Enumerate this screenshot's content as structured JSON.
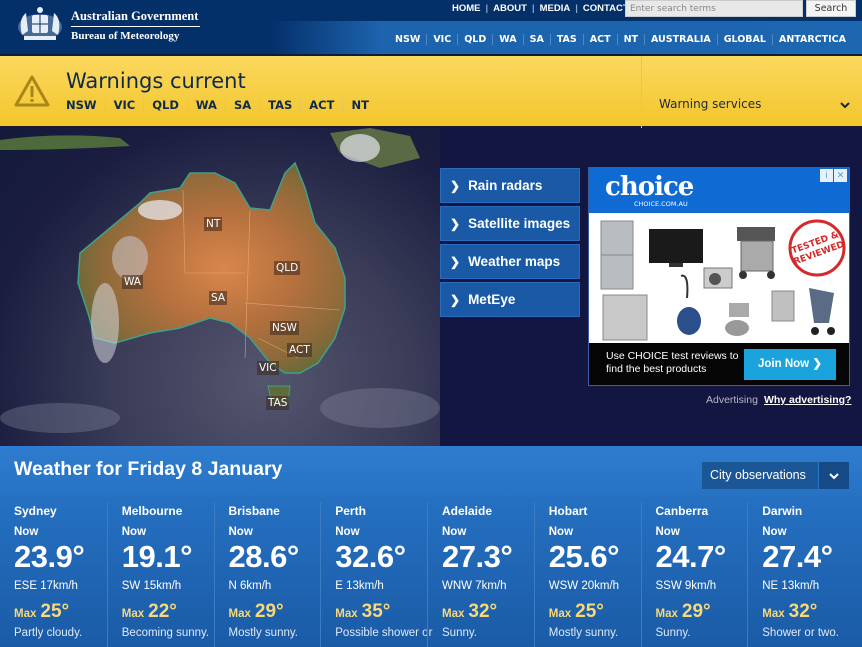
{
  "header": {
    "org_name": "Australian Government",
    "agency_name": "Bureau of Meteorology",
    "top_links": [
      "HOME",
      "ABOUT",
      "MEDIA",
      "CONTACTS"
    ],
    "search_placeholder": "Enter search terms",
    "search_button": "Search",
    "region_links": [
      "NSW",
      "VIC",
      "QLD",
      "WA",
      "SA",
      "TAS",
      "ACT",
      "NT",
      "AUSTRALIA",
      "GLOBAL",
      "ANTARCTICA"
    ]
  },
  "warnings": {
    "title": "Warnings current",
    "states": [
      "NSW",
      "VIC",
      "QLD",
      "WA",
      "SA",
      "TAS",
      "ACT",
      "NT"
    ],
    "services_label": "Warning services",
    "accent_color": "#f5c932"
  },
  "map": {
    "labels": [
      "NT",
      "WA",
      "QLD",
      "SA",
      "NSW",
      "ACT",
      "VIC",
      "TAS"
    ]
  },
  "quick_links": [
    "Rain radars",
    "Satellite images",
    "Weather maps",
    "MetEye"
  ],
  "ad": {
    "brand": "choice",
    "brand_url": "CHOICE.COM.AU",
    "badge": "TESTED & REVIEWED",
    "tagline": "Use CHOICE test reviews to find the best products",
    "cta": "Join Now",
    "footer_label": "Advertising",
    "footer_link": "Why advertising?"
  },
  "weather": {
    "title": "Weather for Friday 8 January",
    "dropdown_label": "City observations",
    "now_label": "Now",
    "max_label": "Max",
    "cities": [
      {
        "name": "Sydney",
        "temp": "23.9°",
        "wind": "ESE 17km/h",
        "max": "25°",
        "desc": "Partly cloudy."
      },
      {
        "name": "Melbourne",
        "temp": "19.1°",
        "wind": "SW 15km/h",
        "max": "22°",
        "desc": "Becoming sunny."
      },
      {
        "name": "Brisbane",
        "temp": "28.6°",
        "wind": "N 6km/h",
        "max": "29°",
        "desc": "Mostly sunny."
      },
      {
        "name": "Perth",
        "temp": "32.6°",
        "wind": "E 13km/h",
        "max": "35°",
        "desc": "Possible shower or"
      },
      {
        "name": "Adelaide",
        "temp": "27.3°",
        "wind": "WNW 7km/h",
        "max": "32°",
        "desc": "Sunny."
      },
      {
        "name": "Hobart",
        "temp": "25.6°",
        "wind": "WSW 20km/h",
        "max": "25°",
        "desc": "Mostly sunny."
      },
      {
        "name": "Canberra",
        "temp": "24.7°",
        "wind": "SSW 9km/h",
        "max": "29°",
        "desc": "Sunny."
      },
      {
        "name": "Darwin",
        "temp": "27.4°",
        "wind": "NE 13km/h",
        "max": "32°",
        "desc": "Shower or two."
      }
    ]
  }
}
